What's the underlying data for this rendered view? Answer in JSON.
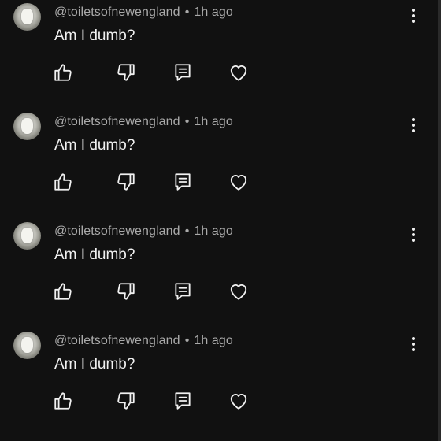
{
  "comments": [
    {
      "author": "@toiletsofnewengland",
      "time": "1h ago",
      "text": "Am I dumb?"
    },
    {
      "author": "@toiletsofnewengland",
      "time": "1h ago",
      "text": "Am I dumb?"
    },
    {
      "author": "@toiletsofnewengland",
      "time": "1h ago",
      "text": "Am I dumb?"
    },
    {
      "author": "@toiletsofnewengland",
      "time": "1h ago",
      "text": "Am I dumb?"
    }
  ],
  "separator": "•",
  "icons": {
    "like": "thumbs-up-icon",
    "dislike": "thumbs-down-icon",
    "reply": "reply-icon",
    "heart": "heart-icon",
    "more": "more-vertical-icon"
  },
  "colors": {
    "background": "#111111",
    "text": "#f1f1f1",
    "meta": "#aaaaaa"
  }
}
